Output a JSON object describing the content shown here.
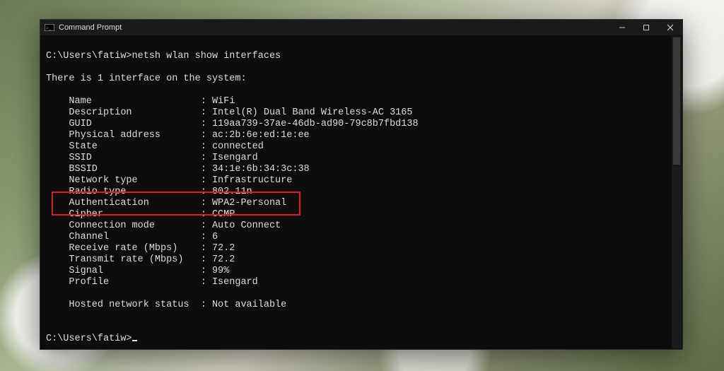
{
  "window": {
    "title": "Command Prompt"
  },
  "terminal": {
    "prompt1_path": "C:\\Users\\fatiw>",
    "prompt1_cmd": "netsh wlan show interfaces",
    "intro": "There is 1 interface on the system:",
    "fields": [
      {
        "label": "Name",
        "value": "WiFi"
      },
      {
        "label": "Description",
        "value": "Intel(R) Dual Band Wireless-AC 3165"
      },
      {
        "label": "GUID",
        "value": "119aa739-37ae-46db-ad90-79c8b7fbd138"
      },
      {
        "label": "Physical address",
        "value": "ac:2b:6e:ed:1e:ee"
      },
      {
        "label": "State",
        "value": "connected"
      },
      {
        "label": "SSID",
        "value": "Isengard"
      },
      {
        "label": "BSSID",
        "value": "34:1e:6b:34:3c:38"
      },
      {
        "label": "Network type",
        "value": "Infrastructure"
      },
      {
        "label": "Radio type",
        "value": "802.11n"
      },
      {
        "label": "Authentication",
        "value": "WPA2-Personal"
      },
      {
        "label": "Cipher",
        "value": "CCMP"
      },
      {
        "label": "Connection mode",
        "value": "Auto Connect"
      },
      {
        "label": "Channel",
        "value": "6"
      },
      {
        "label": "Receive rate (Mbps)",
        "value": "72.2"
      },
      {
        "label": "Transmit rate (Mbps)",
        "value": "72.2"
      },
      {
        "label": "Signal",
        "value": "99%"
      },
      {
        "label": "Profile",
        "value": "Isengard"
      }
    ],
    "hosted_label": "Hosted network status",
    "hosted_value": "Not available",
    "prompt2_path": "C:\\Users\\fatiw>"
  },
  "highlight_index": 9
}
